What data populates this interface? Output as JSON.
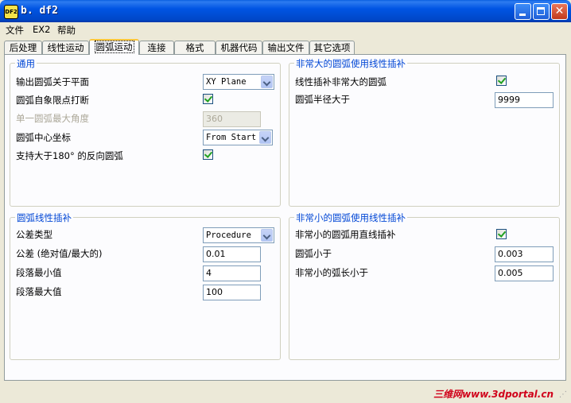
{
  "window": {
    "title": "b. df2",
    "icon_text": "DF2"
  },
  "menu": [
    "文件",
    "EX2",
    "帮助"
  ],
  "tabs": [
    "后处理",
    "线性运动",
    "圆弧运动",
    "连接",
    "格式",
    "机器代码",
    "输出文件",
    "其它选项"
  ],
  "active_tab": "圆弧运动",
  "groups": {
    "general": {
      "title": "通用",
      "output_plane_label": "输出圆弧关于平面",
      "output_plane_value": "XY Plane",
      "break_at_quadrant_label": "圆弧自象限点打断",
      "break_at_quadrant_checked": true,
      "max_angle_label": "单一圆弧最大角度",
      "max_angle_value": "360",
      "center_coord_label": "圆弧中心坐标",
      "center_coord_value": "From Start",
      "reverse_arc_label": "支持大于180° 的反向圆弧",
      "reverse_arc_checked": true
    },
    "large_arc": {
      "title": "非常大的圆弧使用线性插补",
      "linearize_label": "线性插补非常大的圆弧",
      "linearize_checked": true,
      "radius_label": "圆弧半径大于",
      "radius_value": "9999"
    },
    "arc_linearize": {
      "title": "圆弧线性插补",
      "tolerance_type_label": "公差类型",
      "tolerance_type_value": "Procedure",
      "tolerance_label": "公差 (绝对值/最大的)",
      "tolerance_value": "0.01",
      "min_segment_label": "段落最小值",
      "min_segment_value": "4",
      "max_segment_label": "段落最大值",
      "max_segment_value": "100"
    },
    "small_arc": {
      "title": "非常小的圆弧使用线性插补",
      "use_line_label": "非常小的圆弧用直线插补",
      "use_line_checked": true,
      "arc_smaller_label": "圆弧小于",
      "arc_smaller_value": "0.003",
      "arc_length_label": "非常小的弧长小于",
      "arc_length_value": "0.005"
    }
  },
  "watermark": "三维网www.3dportal.cn",
  "colors": {
    "titlebar": "#0054E3",
    "group_title": "#0046D5",
    "checkmark": "#21A121",
    "watermark": "#D0021B"
  }
}
